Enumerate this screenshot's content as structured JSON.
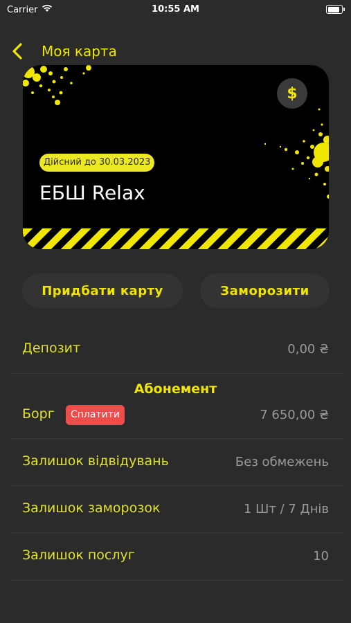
{
  "status_bar": {
    "carrier": "Carrier",
    "time": "10:55 AM"
  },
  "nav": {
    "title": "Моя карта"
  },
  "card": {
    "valid_until": "Дійсний до 30.03.2023",
    "name": "ЕБШ Relax",
    "currency_symbol": "$"
  },
  "actions": {
    "buy_label": "Придбати карту",
    "freeze_label": "Заморозити"
  },
  "deposit": {
    "label": "Депозит",
    "value": "0,00 ₴"
  },
  "subscription": {
    "title": "Абонемент",
    "debt_label": "Борг",
    "pay_label": "Сплатити",
    "debt_value": "7 650,00 ₴"
  },
  "rows": [
    {
      "label": "Залишок відвідувань",
      "value": "Без обмежень"
    },
    {
      "label": "Залишок заморозок",
      "value": "1 Шт / 7 Днів"
    },
    {
      "label": "Залишок послуг",
      "value": "10"
    }
  ],
  "colors": {
    "accent": "#f0e600",
    "background": "#2b2b2b",
    "pay": "#ef4c4c"
  }
}
